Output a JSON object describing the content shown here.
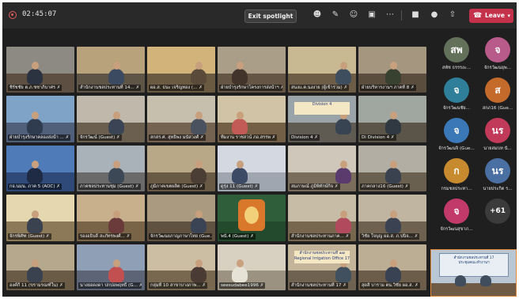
{
  "topbar": {
    "timer": "02:45:07",
    "exit_spotlight_label": "Exit spotlight",
    "leave_label": "Leave"
  },
  "tiles": [
    {
      "label": "ชิรัชชัย ต.ภ.ชชาภิบาศร",
      "wall": "#8d8a83",
      "floor": "#5d5043",
      "person": "#2c3340"
    },
    {
      "label": "สำนักงานชลประทานที่ 14...",
      "wall": "#b8a27c",
      "floor": "#5f5546",
      "person": "#3b4a60"
    },
    {
      "label": "ผอ.ส. ธนะ เจริญทอง (...",
      "wall": "#d2b47a",
      "floor": "#6a5a42",
      "person": "#5a4a3a"
    },
    {
      "label": "ฝ่ายบำรุงรักษาโครงการส่งน้ำฯ",
      "wall": "#aa9e88",
      "floor": "#655544",
      "person": "#42332b"
    },
    {
      "label": "สนงแ.ค.นงงาย (ผู้เข้าร่วม)",
      "wall": "#c9b993",
      "floor": "#6d5d47",
      "person": "#3f4e5f"
    },
    {
      "label": "ฝ่ายบริหารงานฯ ภาคที่ 8",
      "wall": "#a4967f",
      "floor": "#5a4d3e",
      "person": "#384030"
    },
    {
      "label": "ฝ่ายบำรุงรักษาคลองส่งน้ำ ...",
      "wall": "#7ea3c7",
      "floor": "#50607a",
      "person": "#2f3c50"
    },
    {
      "label": "จักรวัฒน์ (Guest)",
      "wall": "#bfb8ab",
      "floor": "#6b5f50",
      "person": "#3a4455"
    },
    {
      "label": "สกสร.ศ. สุทธิพง มนัสวงศ์",
      "wall": "#c7bfae",
      "floor": "#736350",
      "person": "#4a5260"
    },
    {
      "label": "ทีมงาน ราชสวน์ ภอ.สรรพ",
      "wall": "#d1c3a5",
      "floor": "#725f46",
      "person": "#c25a55"
    },
    {
      "label": "Division 4",
      "wall": "#9aa3a8",
      "floor": "#5f5a52",
      "person": "#394452"
    },
    {
      "label": "Di Division 4",
      "wall": "#a0a7a0",
      "floor": "#5b5448",
      "person": "#303842"
    },
    {
      "label": "กอ.นมน. ภาค 5 (AOC)",
      "wall": "#4f7bb8",
      "floor": "#2f4a78",
      "person": "#1f2a44"
    },
    {
      "label": "ภาคชลประทานชุม (Guest)",
      "wall": "#a9b2b8",
      "floor": "#6a6a6a",
      "person": "#3c4856"
    },
    {
      "label": "ภูมิภาคเขตผลิต (Guest)",
      "wall": "#b9a888",
      "floor": "#695a46",
      "person": "#4b3e34"
    },
    {
      "label": "ดูรุ่ง 11 (Guest)",
      "wall": "#d4d8e0",
      "floor": "#a0a6b0",
      "person": "#3d4a66"
    },
    {
      "label": "สมภาษณ์ ภูมิพิทักษ์กิจ",
      "wall": "#cfc7ba",
      "floor": "#7a6d5c",
      "person": "#5b3a6e"
    },
    {
      "label": "ภาคกลาง16 (Guest)",
      "wall": "#b3aea3",
      "floor": "#6a604f",
      "person": "#3a4250"
    },
    {
      "label": "จักรพิศัฑ (Guest)",
      "wall": "#e5d7b0",
      "floor": "#8c7958",
      "person": "#3a4250"
    },
    {
      "label": "รองอธิบดี สะภัทรพงศ์...",
      "wall": "#c9b08c",
      "floor": "#7a6448",
      "person": "#6b3a3a"
    },
    {
      "label": "จักรวัฒนยภาญภาษาไทย (Gue...",
      "wall": "#a99a80",
      "floor": "#5f5240",
      "person": "#3a4455"
    },
    {
      "label": "พนั.4 (Guest)",
      "wall": "#2f5e3a",
      "floor": "#244a2e",
      "person": "#d9772a"
    },
    {
      "label": "สำนักงานชลประทานภาค...",
      "wall": "#c7bca6",
      "floor": "#77674f",
      "person": "#b04a5c"
    },
    {
      "label": "วิชัย ใจบุญ ผอ.ส. ภ.ปนิจ...",
      "wall": "#bfb5a1",
      "floor": "#6e6150",
      "person": "#3b4252"
    },
    {
      "label": "องค์กี 11 (ขรามรณฑ์ใน)",
      "wall": "#b6a88c",
      "floor": "#6a5b46",
      "person": "#3a4250"
    },
    {
      "label": "นางยอดงดา ปกปอพฤทธิ์ (G...",
      "wall": "#8fa0b6",
      "floor": "#5c6476",
      "person": "#c25050"
    },
    {
      "label": "กลุ่มที่ 10 สาขาบางภาพ...",
      "wall": "#cbbea3",
      "floor": "#786850",
      "person": "#4a3c34"
    },
    {
      "label": "seesudabee1996",
      "wall": "#d8d0c0",
      "floor": "#9c9282",
      "person": "#e6e2d6"
    },
    {
      "label": "สำนักงานชลประทานที่ 17",
      "wall": "#c3b49a",
      "floor": "#6f6250",
      "person": "#41505e"
    },
    {
      "label": "สุดสิ บาราม ตน.วิชัย ผอ.ส.",
      "wall": "#bcae95",
      "floor": "#6c5d4a",
      "person": "#384252"
    }
  ],
  "tile_texts": {
    "division_banner": "Division 4",
    "irrigation_banner_line1": "สำนักงานชลประทานที่ ๑๗",
    "irrigation_banner_line2": "Regional Irrigation Office 17"
  },
  "roster": [
    {
      "initials": "สพ",
      "name": "สพัช ธรรรงะ...",
      "color": "#63715a"
    },
    {
      "initials": "จ",
      "name": "จักรวัฒนยุพ...",
      "color": "#b85b8a"
    },
    {
      "initials": "จ",
      "name": "จักรวัฒนชัย...",
      "color": "#2f7f9b"
    },
    {
      "initials": "ส",
      "name": "สกภ16 (Gue...",
      "color": "#c46a2b"
    },
    {
      "initials": "จ",
      "name": "จักรวัฒนจิ (Gue...",
      "color": "#3b78b8"
    },
    {
      "initials": "นร",
      "name": "นายสมบท นั...",
      "color": "#c23a5a"
    },
    {
      "initials": "ก",
      "name": "กรมชลประทา...",
      "color": "#c88a2e"
    },
    {
      "initials": "นร",
      "name": "นายประกิต ร...",
      "color": "#4a6fa3"
    },
    {
      "initials": "จ",
      "name": "จักรวัฒนสุขาภ...",
      "color": "#c23a6a"
    },
    {
      "initials": "+61",
      "name": "",
      "color": "#3b3b3b"
    }
  ],
  "spotlight": {
    "board_line1": "สำนักงานชลประทานที่ 17",
    "board_line2": "ประชุมคณะทำงานฯ"
  }
}
